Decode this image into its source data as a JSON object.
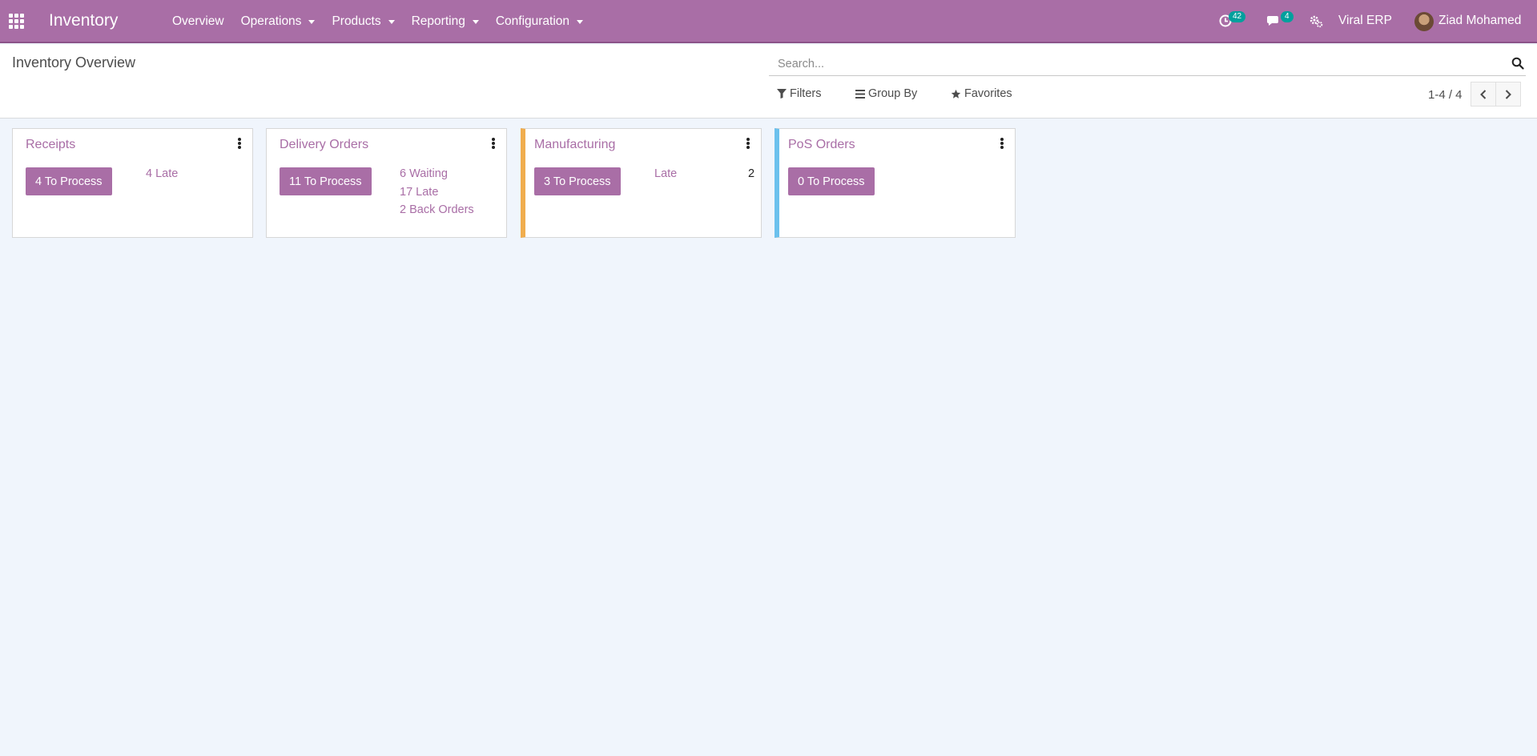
{
  "navbar": {
    "app_name": "Inventory",
    "menu": [
      {
        "label": "Overview"
      },
      {
        "label": "Operations"
      },
      {
        "label": "Products"
      },
      {
        "label": "Reporting"
      },
      {
        "label": "Configuration"
      }
    ],
    "activity_count": "42",
    "messages_count": "4",
    "company": "Viral ERP",
    "user_name": "Ziad Mohamed",
    "icons": [
      "apps-grid-icon",
      "activity-clock-icon",
      "chat-bubbles-icon",
      "debug-gears-icon",
      "avatar"
    ]
  },
  "control_panel": {
    "breadcrumb": "Inventory Overview",
    "search": {
      "placeholder": "Search...",
      "value": ""
    },
    "filters_label": "Filters",
    "groupby_label": "Group By",
    "favorites_label": "Favorites",
    "pager": "1-4 / 4"
  },
  "cards": [
    {
      "title": "Receipts",
      "button": "4 To Process",
      "links": [
        "4 Late"
      ],
      "accent": null
    },
    {
      "title": "Delivery Orders",
      "button": "11 To Process",
      "links": [
        "6 Waiting",
        "17 Late",
        "2 Back Orders"
      ],
      "accent": null
    },
    {
      "title": "Manufacturing",
      "button": "3 To Process",
      "links": [
        "Late"
      ],
      "late_count": "2",
      "accent": "#f0ad4e"
    },
    {
      "title": "PoS Orders",
      "button": "0 To Process",
      "links": [],
      "accent": "#6cc1ed"
    }
  ],
  "colors": {
    "brand": "#a96ea6",
    "background": "#f0f5fc",
    "badge": "#00a09d"
  }
}
